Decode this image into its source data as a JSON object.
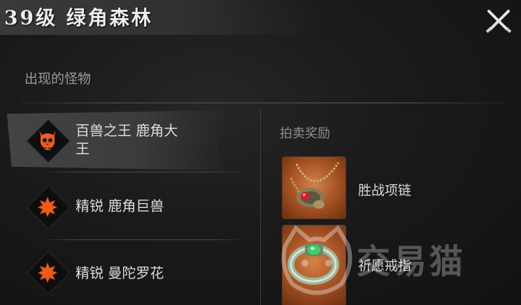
{
  "header": {
    "title": "39级 绿角森林"
  },
  "monsters": {
    "section_title": "出现的怪物",
    "items": [
      {
        "label_line1": "百兽之王 鹿角大",
        "label_line2": "王",
        "icon": "demon-skull-icon"
      },
      {
        "label": "精锐 鹿角巨兽",
        "icon": "elite-star-icon"
      },
      {
        "label": "精锐 曼陀罗花",
        "icon": "elite-star-icon"
      }
    ]
  },
  "rewards": {
    "heading": "拍卖奖励",
    "items": [
      {
        "label": "胜战项链",
        "icon": "necklace-icon"
      },
      {
        "label": "祈愿戒指",
        "icon": "ring-icon"
      }
    ]
  },
  "watermark": {
    "text": "交易猫"
  },
  "colors": {
    "accent_orange": "#f05a1e",
    "background": "#141414",
    "reward_bg": "#a24f22"
  }
}
